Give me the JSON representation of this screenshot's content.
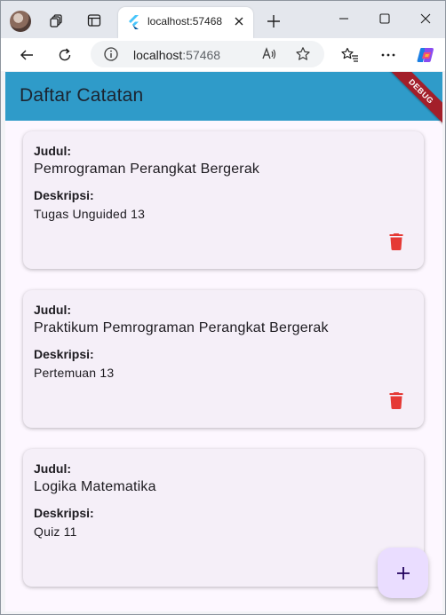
{
  "browser": {
    "tab": {
      "title": "localhost:57468"
    },
    "address_bar": {
      "host": "localhost",
      "port": ":57468"
    }
  },
  "app": {
    "title": "Daftar Catatan",
    "debug_banner": "DEBUG",
    "label_title": "Judul:",
    "label_desc": "Deskripsi:",
    "notes": [
      {
        "title": "Pemrograman Perangkat Bergerak",
        "description": "Tugas Unguided 13"
      },
      {
        "title": "Praktikum Pemrograman Perangkat Bergerak",
        "description": "Pertemuan 13"
      },
      {
        "title": "Logika Matematika",
        "description": "Quiz 11"
      }
    ],
    "fab_icon": "add-icon"
  },
  "colors": {
    "appbar": "#2f9bc9",
    "delete": "#e53935",
    "fab": "#eaddff",
    "card": "#f5eff8"
  }
}
